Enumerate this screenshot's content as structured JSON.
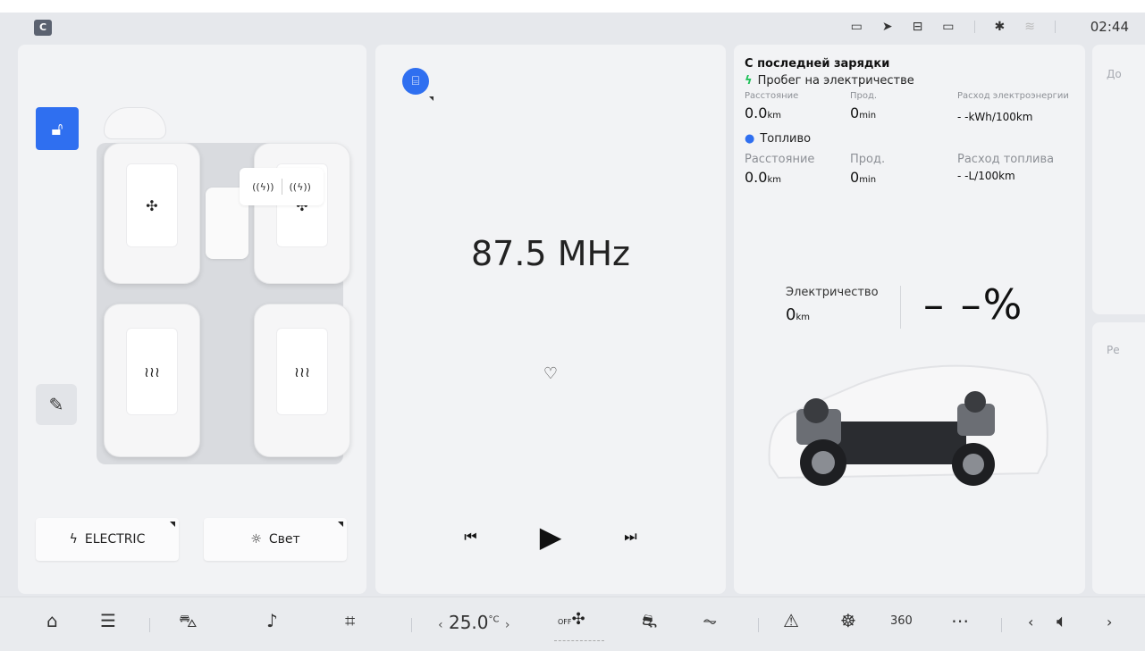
{
  "status_bar": {
    "app_icon": "C",
    "icons": [
      "camera-icon",
      "location-arrow-icon",
      "mail-icon",
      "battery-icon",
      "bluetooth-icon",
      "wifi-off-icon"
    ],
    "clock": "02:44"
  },
  "left_panel": {
    "radio_toggles": [
      "((ϟ))",
      "((ϟ))"
    ],
    "front_left_seat_icon": "fan-icon",
    "front_right_seat_icon": "fan-icon",
    "rear_left_seat_icon": "heat-icon",
    "rear_right_seat_icon": "heat-icon",
    "electric_button": "ELECTRIC",
    "light_button": "Свет"
  },
  "media": {
    "frequency": "87.5 MHz"
  },
  "trip": {
    "title": "С последней зарядки",
    "electric_head": "Пробег на электричестве",
    "e_distance_label": "Расстояние",
    "e_duration_label": "Прод.",
    "e_consumption_label": "Расход электроэнергии",
    "e_distance_value": "0.0",
    "e_distance_unit": "km",
    "e_duration_value": "0",
    "e_duration_unit": "min",
    "e_consumption_value": "- -kWh/100km",
    "fuel_head": "Топливо",
    "f_distance_label": "Расстояние",
    "f_duration_label": "Прод.",
    "f_consumption_label": "Расход топлива",
    "f_distance_value": "0.0",
    "f_distance_unit": "km",
    "f_duration_value": "0",
    "f_duration_unit": "min",
    "f_consumption_value": "- -L/100km",
    "electricity_label": "Электричество",
    "electricity_range_value": "0",
    "electricity_range_unit": "km",
    "battery_percent": "– –%"
  },
  "edge_cards": {
    "top": "До",
    "bottom": "Ре"
  },
  "dock": {
    "temperature": "25.0",
    "temperature_unit": "°C",
    "fan_state": "OFF"
  }
}
